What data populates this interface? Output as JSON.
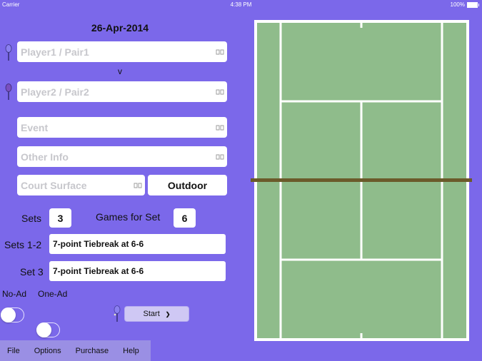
{
  "status_bar": {
    "carrier": "Carrier",
    "time": "4:38 PM",
    "battery": "100%"
  },
  "match": {
    "date": "26-Apr-2014",
    "player1_placeholder": "Player1 / Pair1",
    "versus": "v",
    "player2_placeholder": "Player2 / Pair2",
    "event_placeholder": "Event",
    "other_info_placeholder": "Other Info",
    "court_surface_placeholder": "Court Surface",
    "venue_type": "Outdoor"
  },
  "format": {
    "sets_label": "Sets",
    "sets_value": "3",
    "games_label": "Games for Set",
    "games_value": "6",
    "sets12_label": "Sets 1-2",
    "sets12_value": "7-point Tiebreak at 6-6",
    "set3_label": "Set 3",
    "set3_value": "7-point Tiebreak at 6-6",
    "no_ad_label": "No-Ad",
    "no_ad_on": false,
    "one_ad_label": "One-Ad",
    "one_ad_on": false
  },
  "start_button": {
    "label": "Start",
    "chevron": "❯"
  },
  "menu": {
    "items": [
      "File",
      "Options",
      "Purchase",
      "Help"
    ]
  },
  "colors": {
    "background": "#7b68ea",
    "court": "#8fbc8b",
    "lines": "#ffffff",
    "net": "#6b5a2a"
  }
}
